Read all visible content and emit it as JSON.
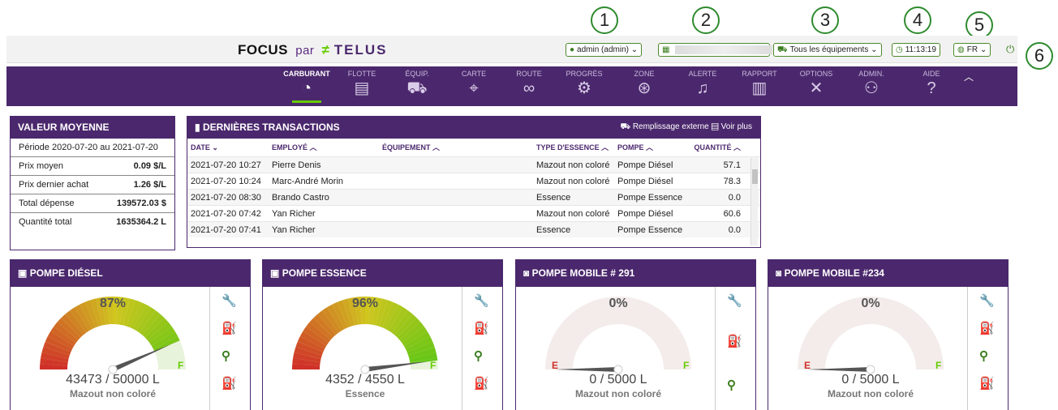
{
  "callouts": [
    "1",
    "2",
    "3",
    "4",
    "5",
    "6"
  ],
  "brand": {
    "focus": "FOCUS",
    "par": "par",
    "telus": "TELUS"
  },
  "topbar": {
    "user": "admin (admin)",
    "equipment_filter": "Tous les équipements",
    "clock": "11:13:19",
    "language": "FR"
  },
  "nav": {
    "items": [
      {
        "label": "CARBURANT",
        "icon": "gauge-icon",
        "glyph": "◔"
      },
      {
        "label": "FLOTTE",
        "icon": "bus-icon",
        "glyph": "▤"
      },
      {
        "label": "ÉQUIP.",
        "icon": "truck-icon",
        "glyph": "⛟"
      },
      {
        "label": "CARTE",
        "icon": "map-icon",
        "glyph": "⌖"
      },
      {
        "label": "ROUTE",
        "icon": "route-icon",
        "glyph": "∞"
      },
      {
        "label": "PROGRÈS",
        "icon": "progress-icon",
        "glyph": "⚙"
      },
      {
        "label": "ZONE",
        "icon": "zone-icon",
        "glyph": "⊛"
      },
      {
        "label": "ALERTE",
        "icon": "bell-icon",
        "glyph": "🔔"
      },
      {
        "label": "RAPPORT",
        "icon": "report-icon",
        "glyph": "▥"
      },
      {
        "label": "OPTIONS",
        "icon": "tools-icon",
        "glyph": "✕"
      },
      {
        "label": "ADMIN.",
        "icon": "admin-icon",
        "glyph": "⚇"
      },
      {
        "label": "AIDE",
        "icon": "help-icon",
        "glyph": "?"
      }
    ]
  },
  "avg": {
    "title": "VALEUR MOYENNE",
    "period": "Période 2020-07-20 au 2021-07-20",
    "rows": [
      {
        "label": "Prix moyen",
        "value": "0.09 $/L"
      },
      {
        "label": "Prix dernier achat",
        "value": "1.26 $/L"
      },
      {
        "label": "Total dépense",
        "value": "139572.03 $"
      },
      {
        "label": "Quantité total",
        "value": "1635364.2 L"
      }
    ]
  },
  "transactions": {
    "title": "DERNIÈRES TRANSACTIONS",
    "external": "Remplissage externe",
    "more": "Voir plus",
    "columns": [
      "DATE",
      "EMPLOYÉ",
      "ÉQUIPEMENT",
      "TYPE D'ESSENCE",
      "POMPE",
      "QUANTITÉ"
    ],
    "rows": [
      [
        "2021-07-20 10:27",
        "Pierre Denis",
        "",
        "Mazout non coloré",
        "Pompe Diésel",
        "57.1"
      ],
      [
        "2021-07-20 10:24",
        "Marc-André Morin",
        "",
        "Mazout non coloré",
        "Pompe Diésel",
        "78.3"
      ],
      [
        "2021-07-20 08:30",
        "Brando Castro",
        "",
        "Essence",
        "Pompe Essence",
        "0.0"
      ],
      [
        "2021-07-20 07:42",
        "Yan Richer",
        "",
        "Mazout non coloré",
        "Pompe Diésel",
        "60.6"
      ],
      [
        "2021-07-20 07:41",
        "Yan Richer",
        "",
        "Essence",
        "Pompe Essence",
        "0.0"
      ]
    ]
  },
  "pumps": [
    {
      "title": "POMPE DIÉSEL",
      "percent": "87%",
      "level": 0.87,
      "reading": "43473 / 50000 L",
      "fuel": "Mazout non coloré",
      "mobile": false
    },
    {
      "title": "POMPE ESSENCE",
      "percent": "96%",
      "level": 0.96,
      "reading": "4352 / 4550 L",
      "fuel": "Essence",
      "mobile": false
    },
    {
      "title": "POMPE MOBILE # 291",
      "percent": "0%",
      "level": 0.0,
      "reading": "0 / 5000 L",
      "fuel": "Mazout non coloré",
      "mobile": true
    },
    {
      "title": "POMPE MOBILE #234",
      "percent": "0%",
      "level": 0.0,
      "reading": "0 / 5000 L",
      "fuel": "Mazout non coloré",
      "mobile": true
    }
  ],
  "gauge_labels": {
    "empty": "E",
    "full": "F"
  },
  "colors": {
    "brand_purple": "#4b286d",
    "brand_green": "#66cc00",
    "low_red": "#d0302a"
  }
}
